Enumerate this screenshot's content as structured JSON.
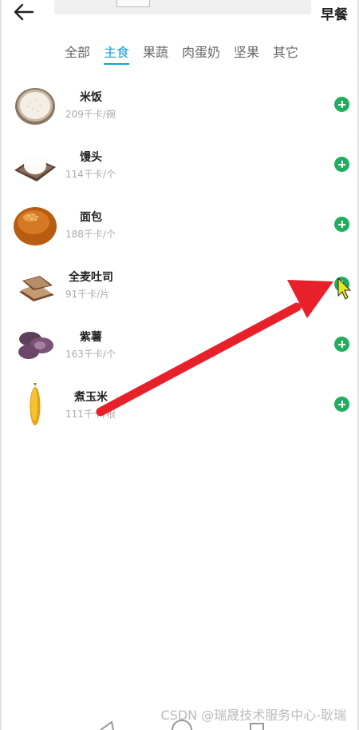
{
  "header": {
    "back_icon": "arrow-left-icon",
    "meal": "早餐"
  },
  "tabs": [
    {
      "label": "全部",
      "active": false
    },
    {
      "label": "主食",
      "active": true
    },
    {
      "label": "果蔬",
      "active": false
    },
    {
      "label": "肉蛋奶",
      "active": false
    },
    {
      "label": "坚果",
      "active": false
    },
    {
      "label": "其它",
      "active": false
    }
  ],
  "foods": [
    {
      "name": "米饭",
      "calories": "209千卡/碗",
      "icon": "rice-bowl-icon"
    },
    {
      "name": "馒头",
      "calories": "114千卡/个",
      "icon": "steamed-bun-icon"
    },
    {
      "name": "面包",
      "calories": "188千卡/个",
      "icon": "bread-icon"
    },
    {
      "name": "全麦吐司",
      "calories": "91千卡/片",
      "icon": "toast-icon"
    },
    {
      "name": "紫薯",
      "calories": "163千卡/个",
      "icon": "purple-sweet-potato-icon"
    },
    {
      "name": "煮玉米",
      "calories": "111千卡/根",
      "icon": "corn-icon"
    }
  ],
  "colors": {
    "accent": "#1a9bd7",
    "add": "#1fae5e",
    "annotation_arrow": "#e8202a"
  },
  "watermark": "CSDN @瑞晟技术服务中心-耿瑞"
}
